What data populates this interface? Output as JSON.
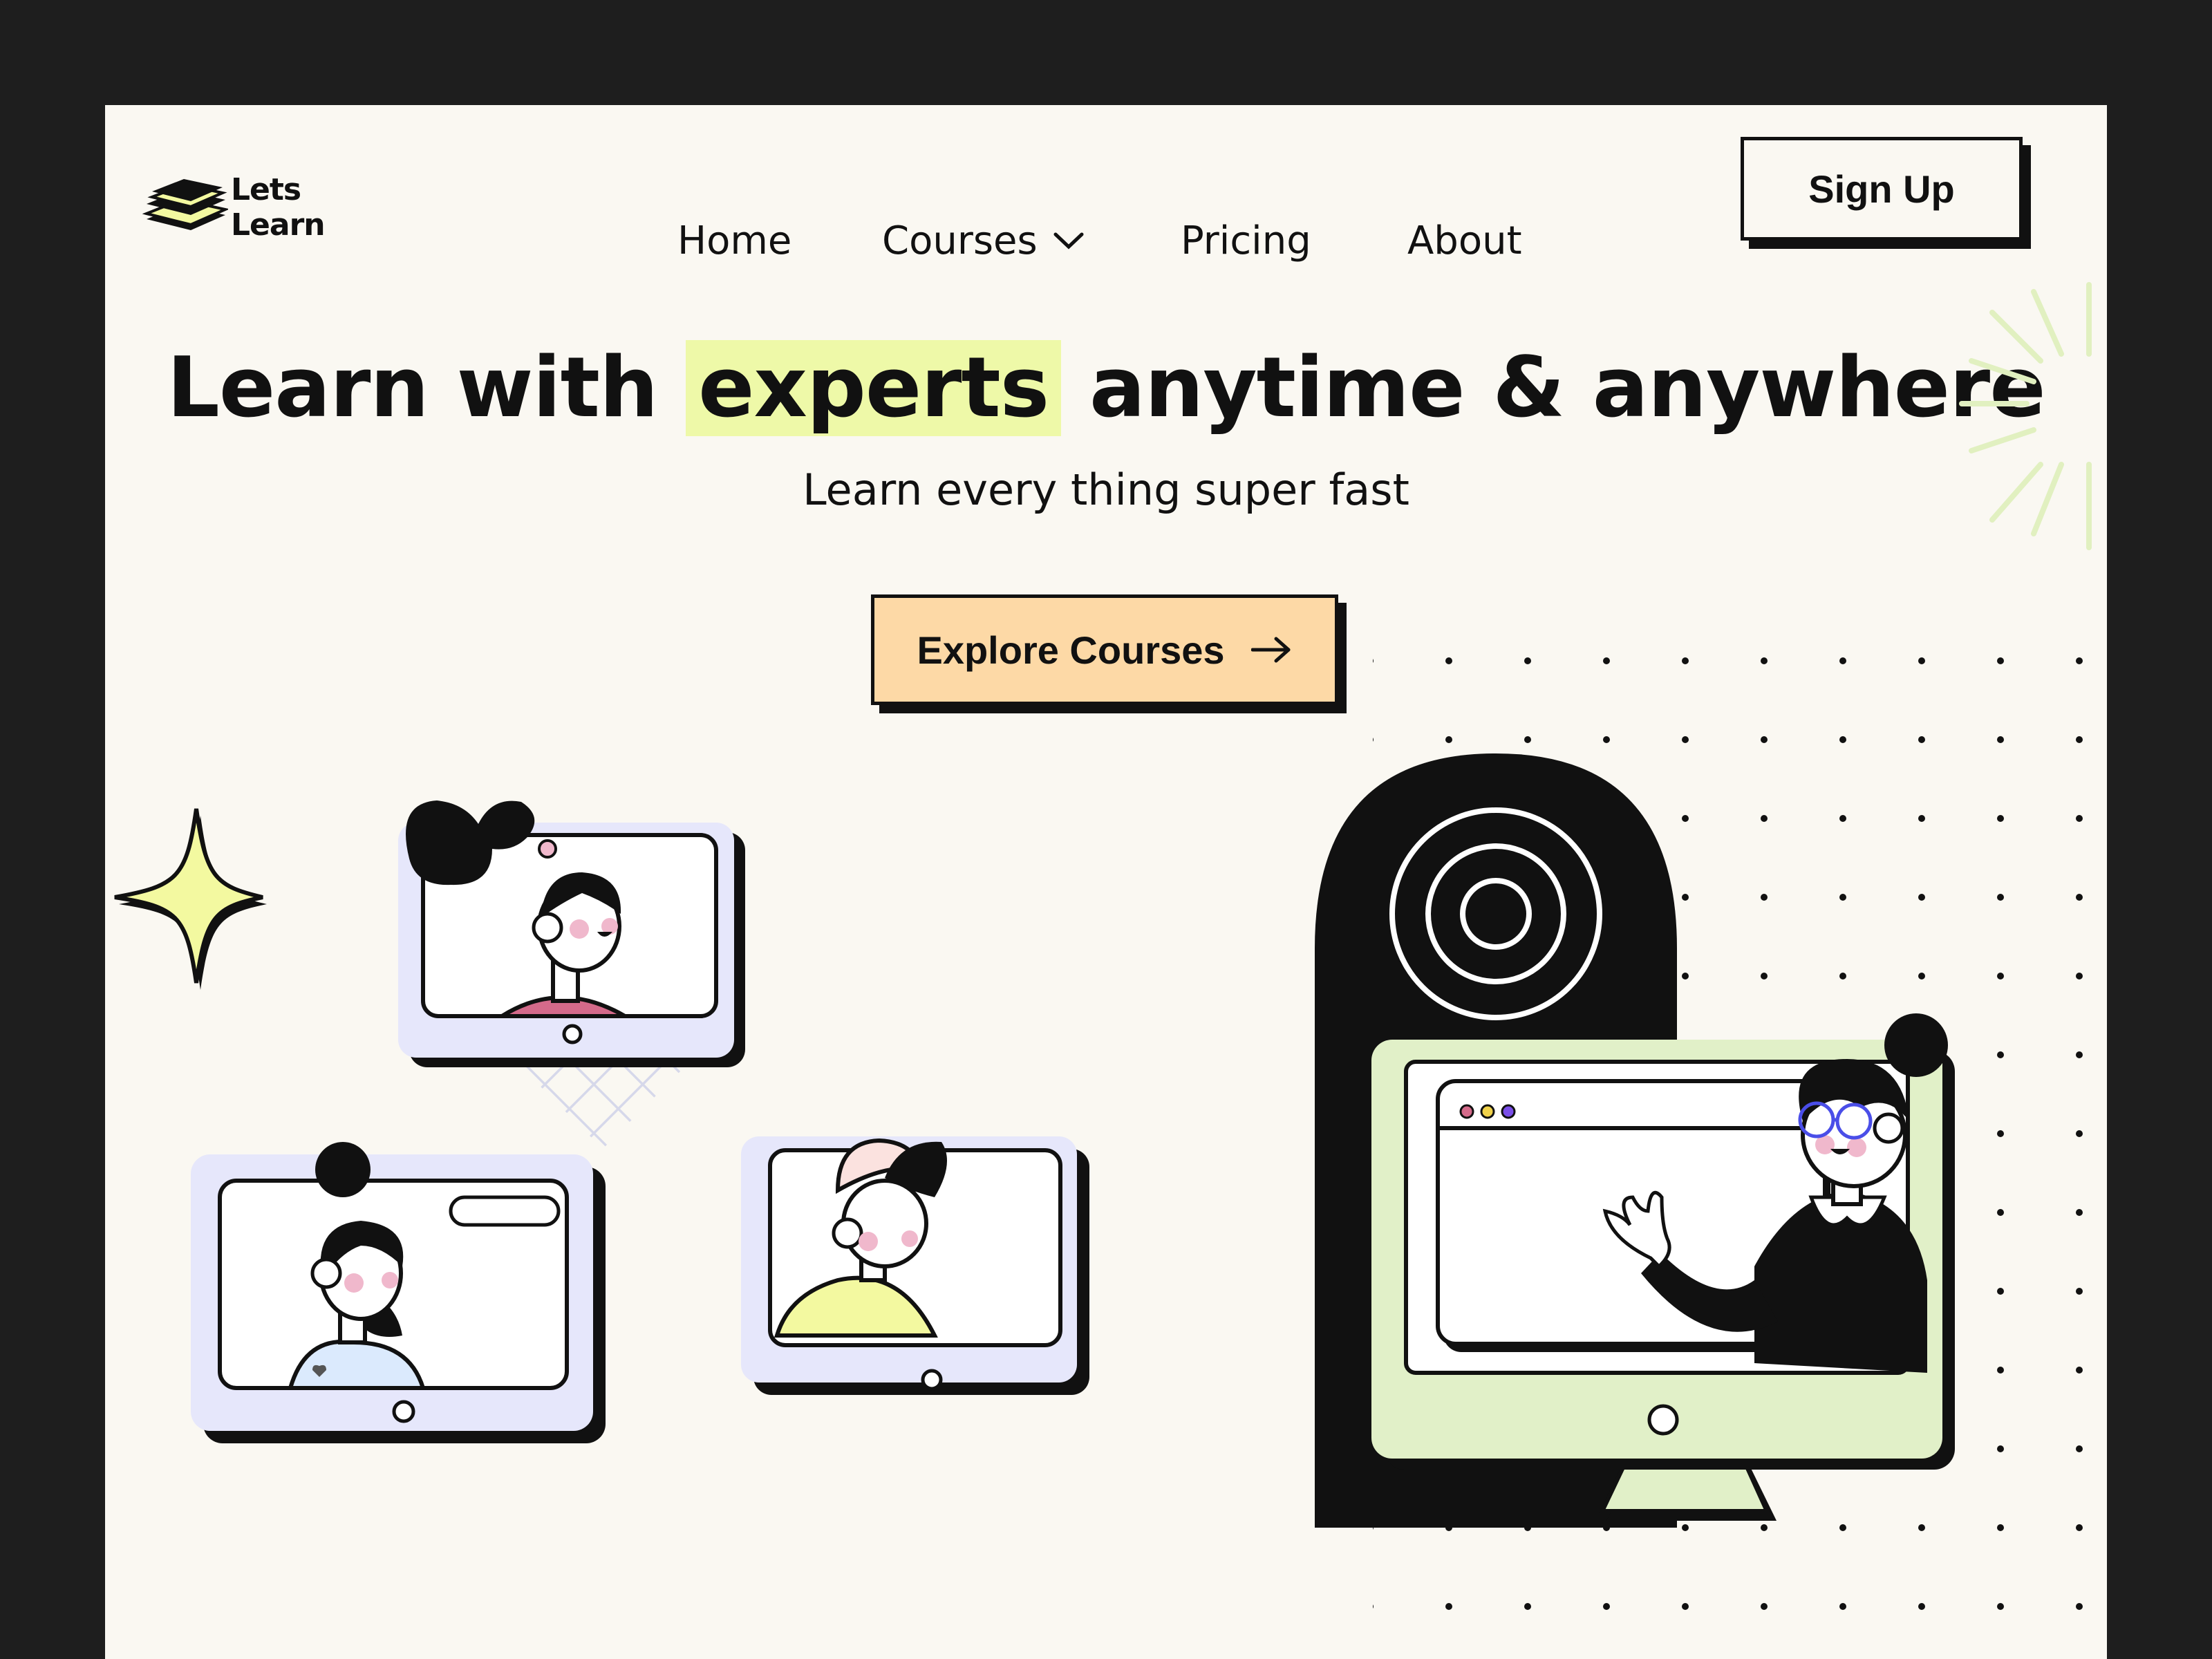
{
  "brand": {
    "name": "Lets Learn",
    "icon": "stacked-books-logo-icon"
  },
  "nav": {
    "items": [
      {
        "label": "Home"
      },
      {
        "label": "Courses",
        "icon": "chevron-down-icon"
      },
      {
        "label": "Pricing"
      },
      {
        "label": "About"
      }
    ],
    "signup_label": "Sign Up"
  },
  "hero": {
    "title_before": "Learn with",
    "title_highlight": "experts",
    "title_after": "anytime & anywhere",
    "subtitle": "Learn every thing super fast",
    "cta_label": "Explore Courses",
    "cta_icon": "arrow-right-icon"
  },
  "colors": {
    "frame": "#1e1e1e",
    "page_bg": "#faf8f2",
    "highlight": "#eef9a8",
    "cta_bg": "#fdd9a6",
    "tablet_bg": "#e6e7fb",
    "monitor_bg": "#e1f0c8",
    "sparkle": "#f3f9a0",
    "accent_pink": "#d46a8a",
    "accent_blue": "#4a4ee8"
  }
}
